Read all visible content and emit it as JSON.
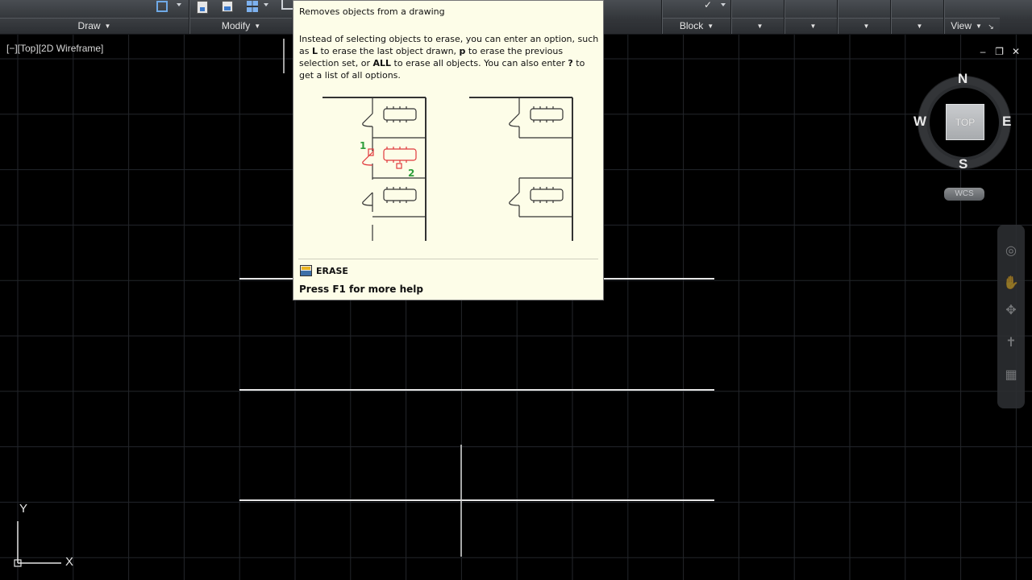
{
  "ribbon": {
    "panels": [
      {
        "label": "Draw"
      },
      {
        "label": "Modify"
      },
      {
        "label": "Block"
      },
      {
        "label": "View"
      }
    ],
    "colors": {
      "background": "#33363a",
      "text": "#e4e4e4"
    }
  },
  "viewport": {
    "label": "[−][Top][2D Wireframe]",
    "controls": [
      "minimize-icon",
      "restore-icon",
      "close-icon"
    ],
    "control_glyphs": [
      "‒",
      "❐",
      "✕"
    ],
    "background": "#000000",
    "grid_color": "#2a2d33"
  },
  "compass": {
    "north": "N",
    "south": "S",
    "east": "E",
    "west": "W",
    "top_face": "TOP",
    "wcs_label": "WCS"
  },
  "ucs": {
    "x_label": "X",
    "y_label": "Y"
  },
  "tooltip": {
    "summary": "Removes objects from a drawing",
    "description_html": "Instead of selecting objects to erase, you can enter an option, such as <b>L</b> to erase the last object drawn, <b>p</b> to erase the previous selection set, or <b>ALL</b> to erase all objects. You can also enter <b>?</b> to get a list of all options.",
    "figure_labels": [
      "1",
      "2"
    ],
    "command_name": "ERASE",
    "help_text": "Press F1 for more help",
    "colors": {
      "background": "#fdfde8",
      "highlight": "#e0383b",
      "pick_label": "#2e9e3a"
    }
  }
}
